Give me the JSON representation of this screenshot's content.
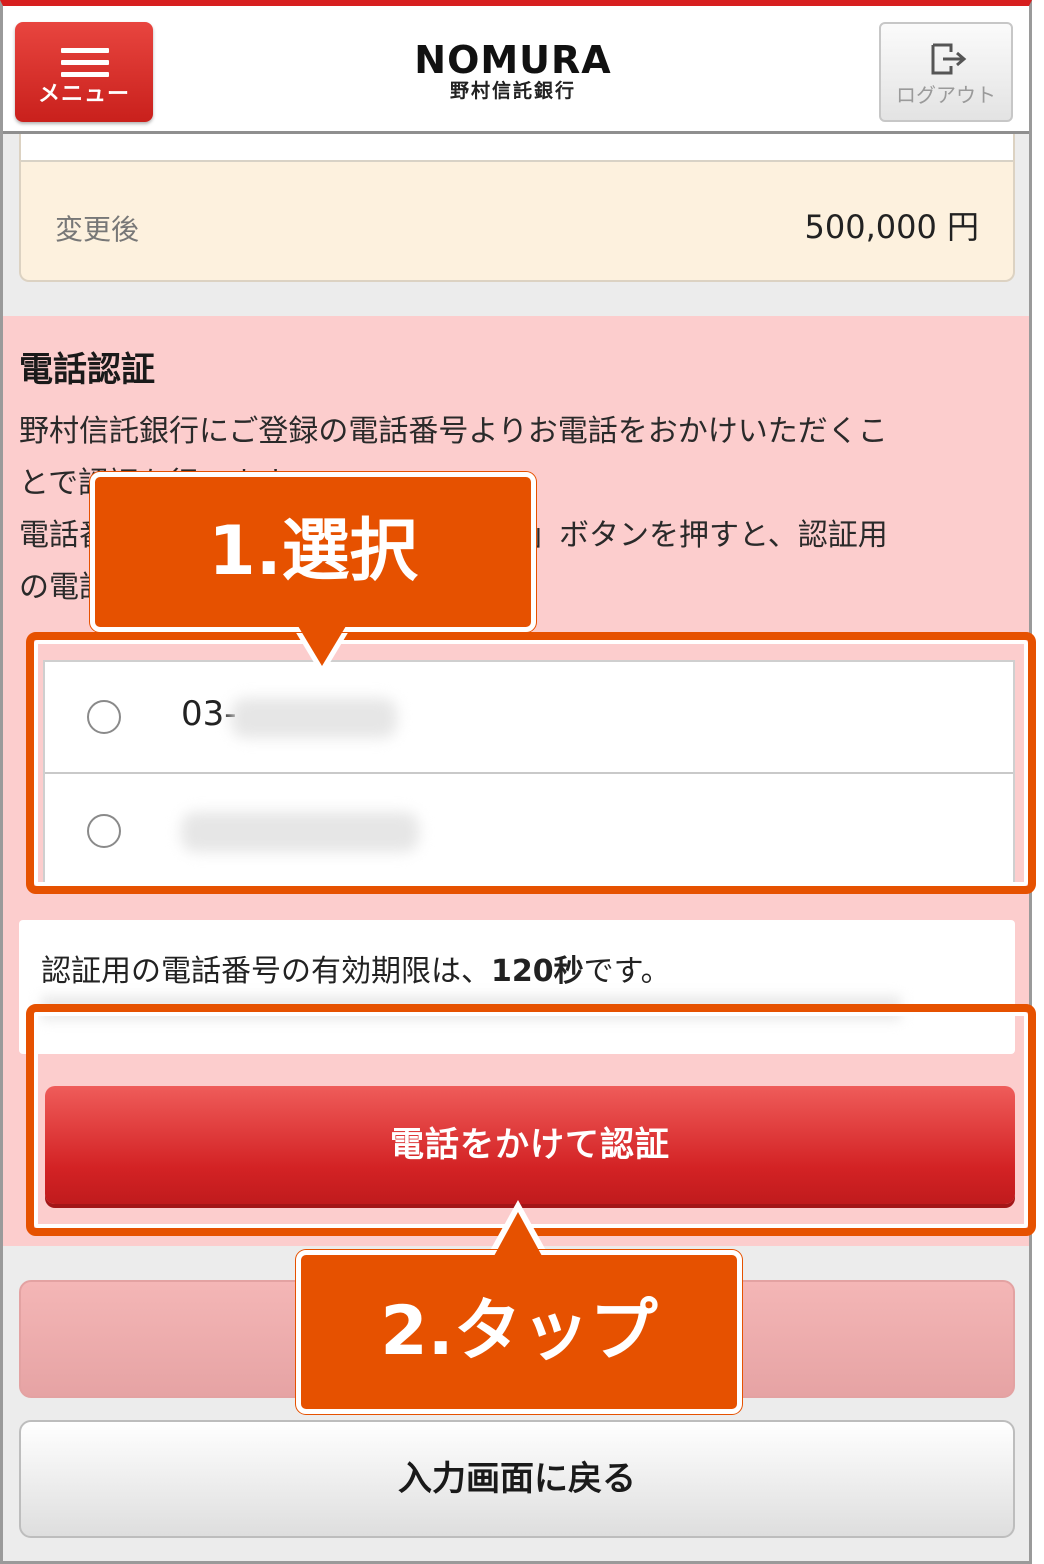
{
  "header": {
    "menu_label": "メニュー",
    "logo_en": "NOMURA",
    "logo_jp": "野村信託銀行",
    "logout_label": "ログアウト"
  },
  "amount": {
    "label": "変更後",
    "value": "500,000 円"
  },
  "auth": {
    "title": "電話認証",
    "desc_line1": "野村信託銀行にご登録の電話番号よりお電話をおかけいただくこ",
    "desc_line2": "とで認証を行います。",
    "desc_line3": "電話番号を選択し「電話をかけて認証」ボタンを押すと、認証用",
    "desc_line4": "の電話番号が表示されます。",
    "phones": [
      {
        "visible_prefix": "03-"
      },
      {
        "visible_prefix": ""
      }
    ],
    "notice_pre": "認証用の電話番号の有効期限は、",
    "notice_bold": "120秒",
    "notice_post": "です。",
    "call_button": "電話をかけて認証"
  },
  "footer": {
    "back_button": "入力画面に戻る"
  },
  "annotations": {
    "step1": "1.選択",
    "step2": "2.タップ",
    "color": "#e65100"
  },
  "colors": {
    "brand_red": "#d32224",
    "section_bg": "#fccdcd",
    "amount_bg": "#fdf1de"
  }
}
